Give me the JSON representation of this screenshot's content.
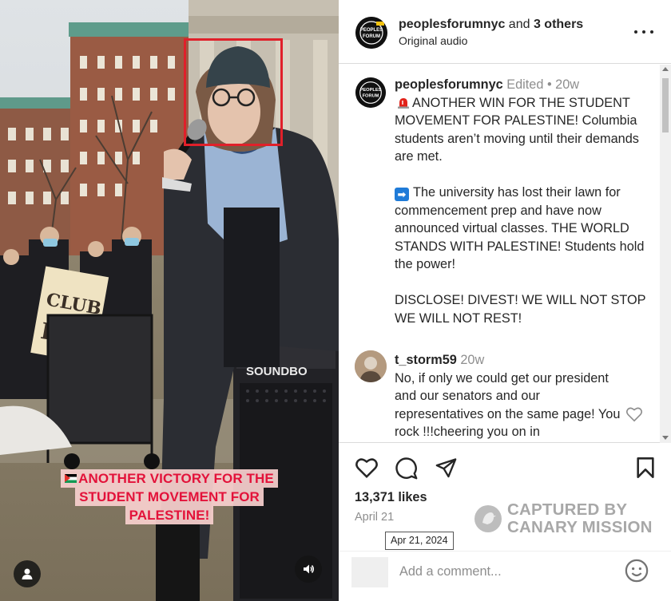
{
  "video": {
    "caption_lines": [
      "ANOTHER VICTORY FOR THE",
      "STUDENT MOVEMENT FOR",
      "PALESTINE!"
    ],
    "sign_text": "CLUB FAIR",
    "speaker_brand": "SOUNDBOKS",
    "user_icon": "user-icon",
    "sound_icon": "speaker-icon",
    "highlight_color": "#e0202a"
  },
  "header": {
    "username": "peoplesforumnyc",
    "collab_text": " and ",
    "collab_others": "3 others",
    "audio": "Original audio",
    "avatar_label": "THE PEOPLES FORUM"
  },
  "post": {
    "username": "peoplesforumnyc",
    "edited": "Edited",
    "separator": " • ",
    "age": "20w",
    "line1": "ANOTHER WIN FOR THE STUDENT MOVEMENT FOR PALESTINE! Columbia students aren’t moving until their demands are met.",
    "line2": "The university has lost their lawn for commencement prep and have now announced virtual classes. THE WORLD STANDS WITH PALESTINE! Students hold the power!",
    "line3": "DISCLOSE! DIVEST! WE WILL NOT STOP WE WILL NOT REST!"
  },
  "comment": {
    "username": "t_storm59",
    "age": "20w",
    "text": "No, if only we could get our president and our senators and our representatives on the same page! You rock !!!cheering you on in"
  },
  "actions": {
    "likes": "13,371 likes",
    "date": "April 21",
    "tooltip": "Apr 21, 2024"
  },
  "comment_bar": {
    "placeholder": "Add a comment..."
  },
  "watermark": {
    "line1": "CAPTURED BY",
    "line2": "CANARY MISSION"
  },
  "colors": {
    "caption_text": "#e3123a",
    "caption_bg": "#f8d0ce",
    "arrow_emoji": "#1f7bd8"
  }
}
